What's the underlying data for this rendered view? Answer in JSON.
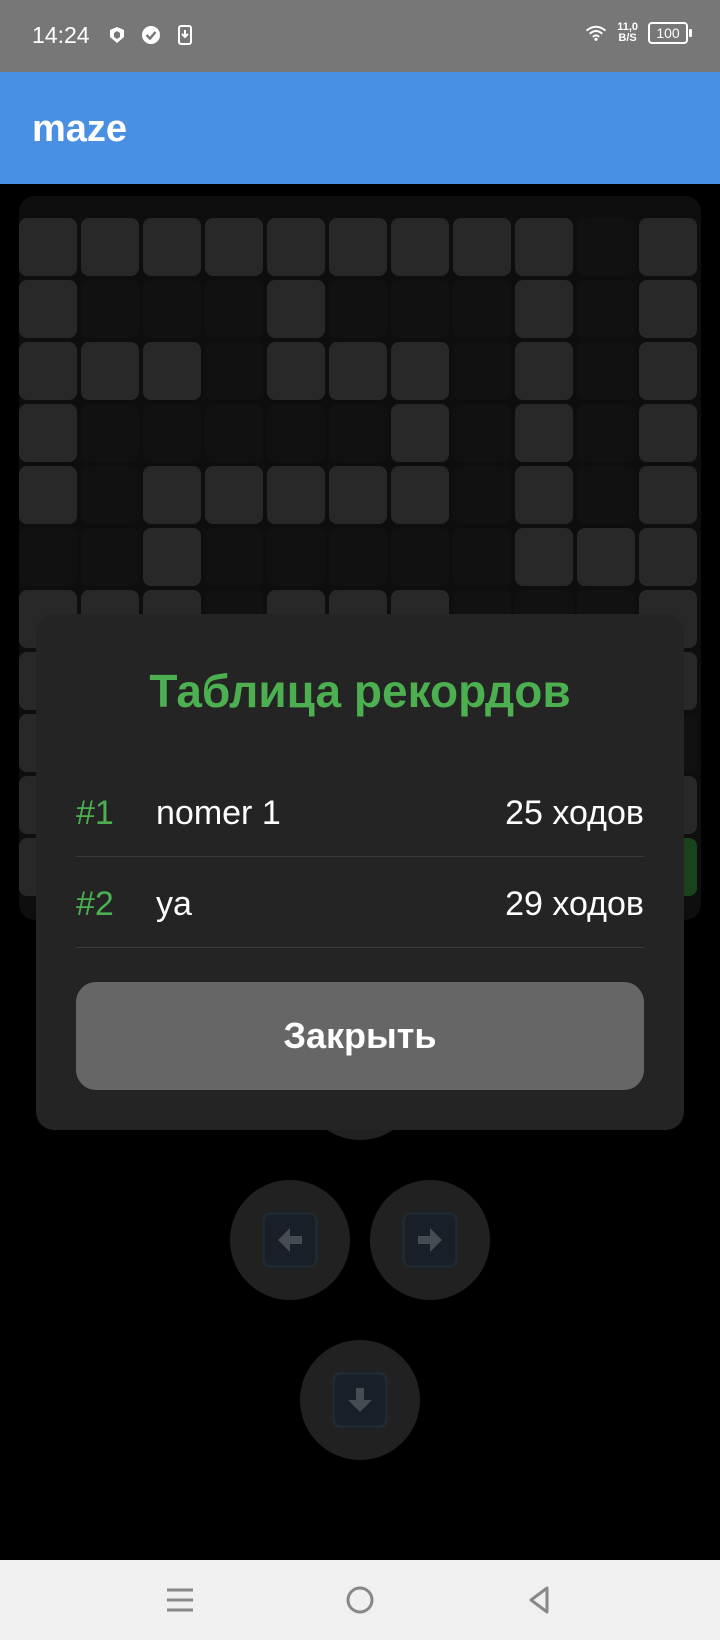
{
  "status_bar": {
    "time": "14:24",
    "speed_value": "11,0",
    "speed_unit": "B/S",
    "battery": "100",
    "icons": [
      "shield-icon",
      "check-circle-icon",
      "download-icon",
      "wifi-icon"
    ]
  },
  "app": {
    "title": "maze"
  },
  "maze": {
    "colors": {
      "wall": "#4a4a4a",
      "path": "#1f1f1f",
      "exit": "#2f7d32"
    },
    "rows": [
      "WWWWWWWWWPW",
      "WPPPWPPPWPW",
      "WWWPWWWPWPW",
      "WPPPPPWPWPW",
      "WPWWWWWPWPW",
      "PPWPPPPPWWW",
      "WWWPWWWPPPW",
      "WPPPPPWPPPW",
      "WPWWWPPPPPP",
      "WPPPWPPPWPW",
      "WWWWWWWWWPE"
    ]
  },
  "controls": {
    "up": "up-arrow-icon",
    "left": "left-arrow-icon",
    "right": "right-arrow-icon",
    "down": "down-arrow-icon"
  },
  "dialog": {
    "title": "Таблица рекордов",
    "accent_color": "#4caf50",
    "scores": [
      {
        "rank": "#1",
        "name": "nomer 1",
        "moves": "25 ходов"
      },
      {
        "rank": "#2",
        "name": "ya",
        "moves": "29 ходов"
      }
    ],
    "close_label": "Закрыть"
  },
  "nav_bar": {
    "buttons": [
      "menu-icon",
      "home-icon",
      "back-icon"
    ]
  }
}
